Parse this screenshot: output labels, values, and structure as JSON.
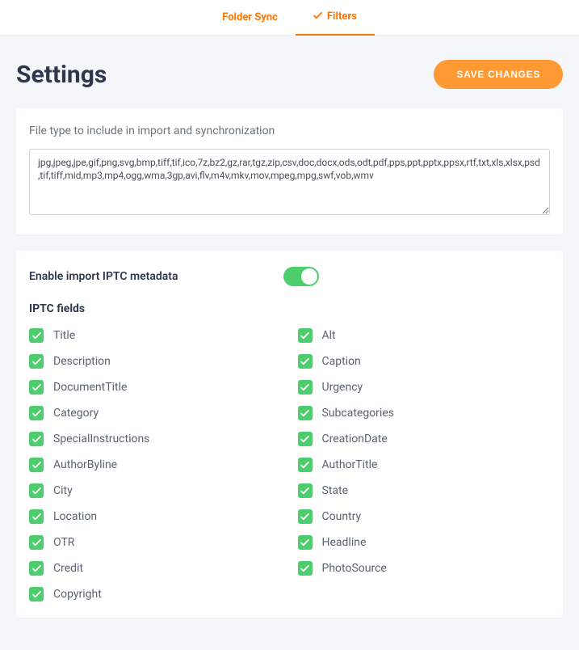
{
  "tabs": {
    "folder_sync": "Folder Sync",
    "filters": "Filters"
  },
  "page_title": "Settings",
  "save_button": "SAVE CHANGES",
  "file_type_label": "File type to include in import and synchronization",
  "file_type_value": "jpg,jpeg,jpe,gif,png,svg,bmp,tiff,tif,ico,7z,bz2,gz,rar,tgz,zip,csv,doc,docx,ods,odt,pdf,pps,ppt,pptx,ppsx,rtf,txt,xls,xlsx,psd,tif,tiff,mid,mp3,mp4,ogg,wma,3gp,avi,flv,m4v,mkv,mov,mpeg,mpg,swf,vob,wmv",
  "iptc": {
    "toggle_label": "Enable import IPTC metadata",
    "toggle_on": true,
    "section_title": "IPTC fields",
    "left": [
      "Title",
      "Description",
      "DocumentTitle",
      "Category",
      "SpecialInstructions",
      "AuthorByline",
      "City",
      "Location",
      "OTR",
      "Credit",
      "Copyright"
    ],
    "right": [
      "Alt",
      "Caption",
      "Urgency",
      "Subcategories",
      "CreationDate",
      "AuthorTitle",
      "State",
      "Country",
      "Headline",
      "PhotoSource"
    ]
  }
}
